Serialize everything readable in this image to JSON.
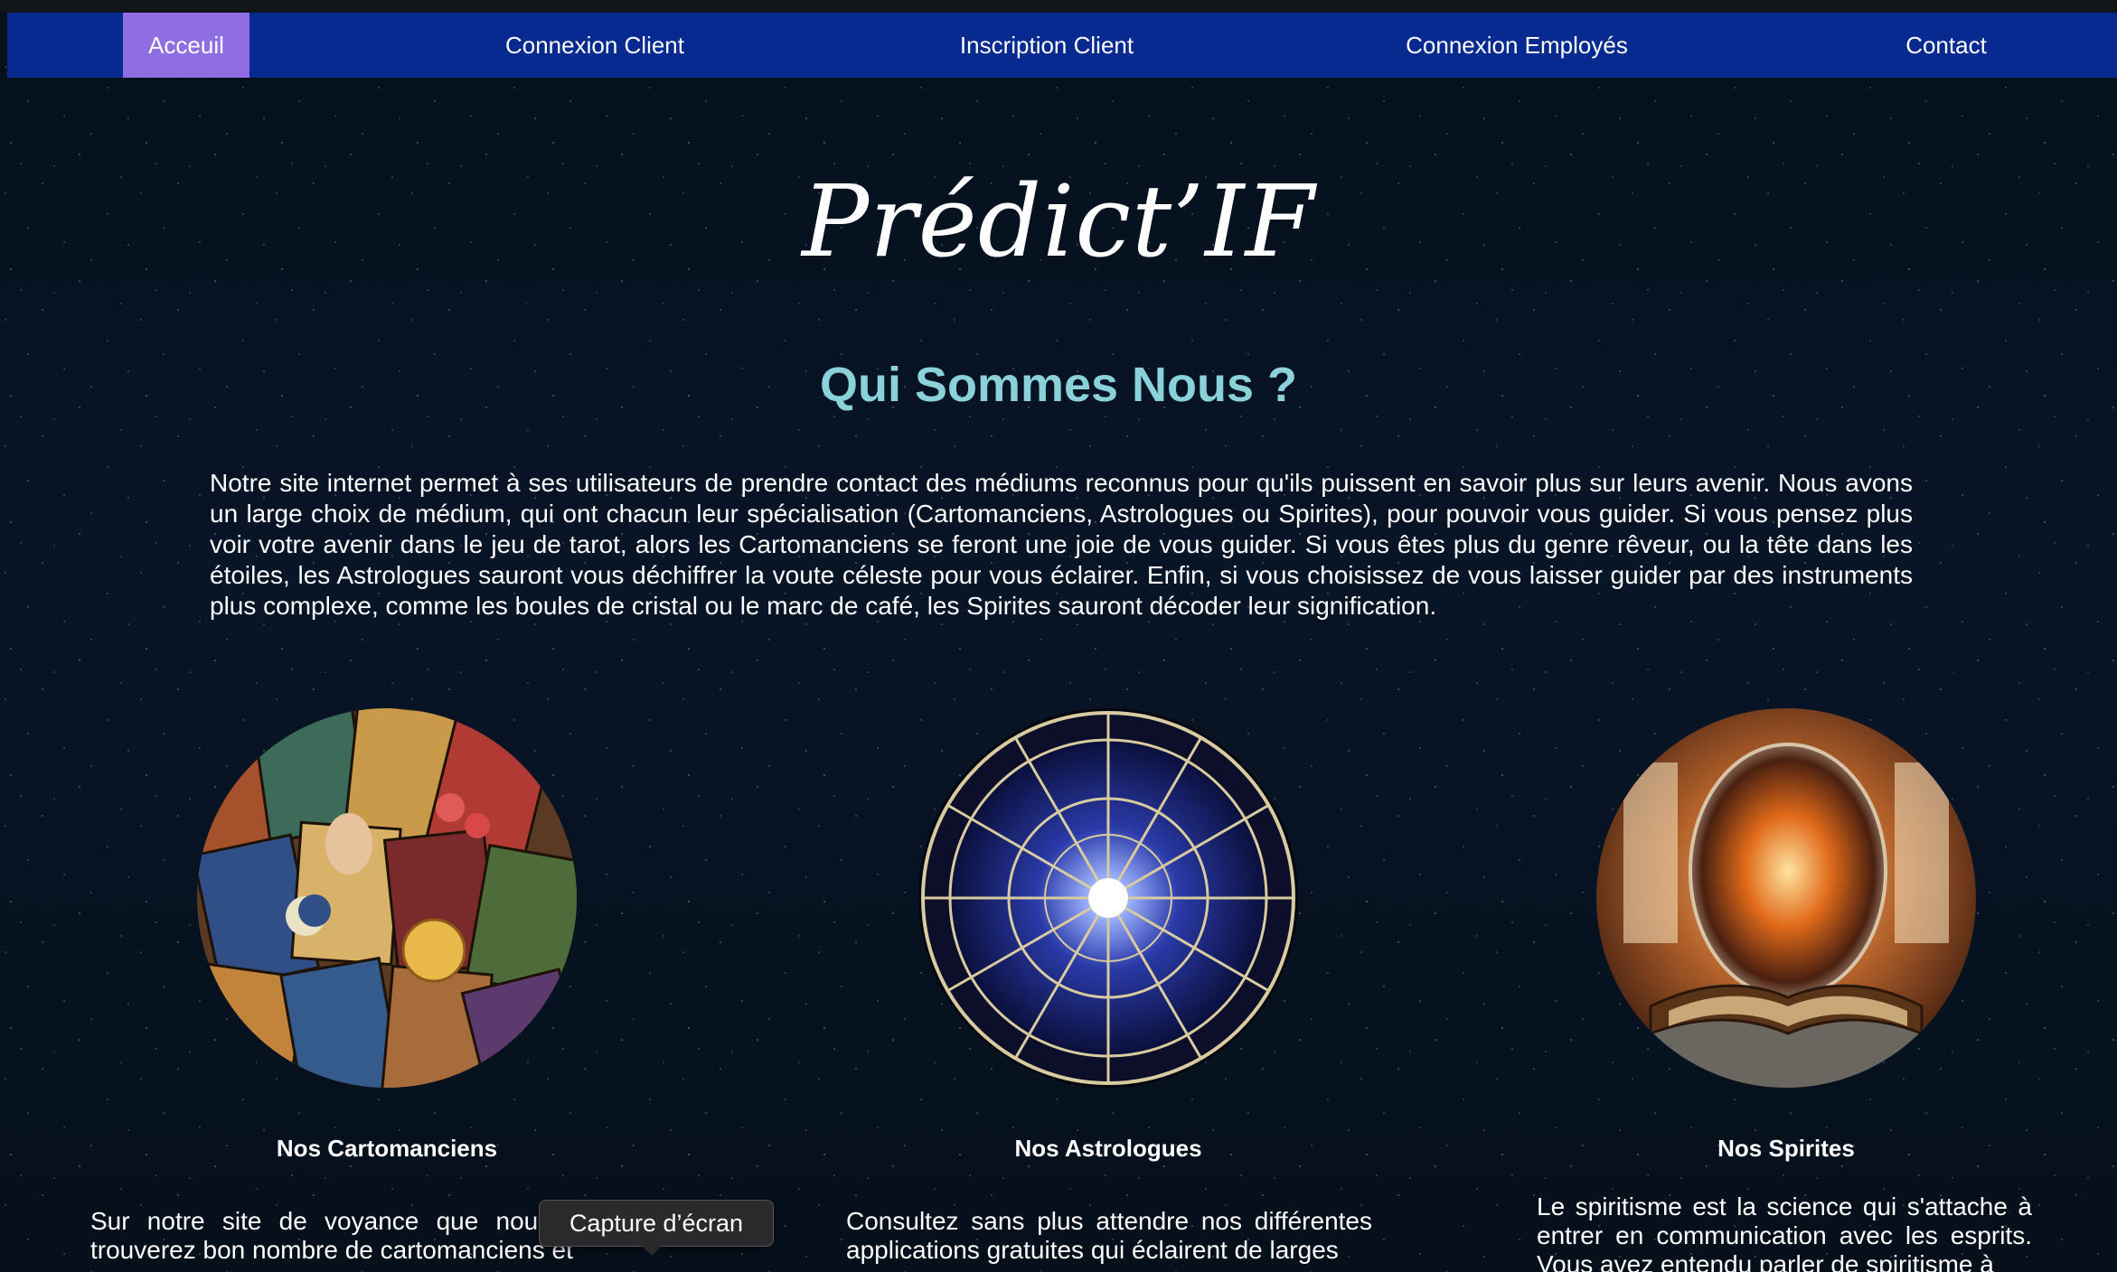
{
  "nav": {
    "items": [
      {
        "label": "Acceuil",
        "active": true
      },
      {
        "label": "Connexion Client",
        "active": false
      },
      {
        "label": "Inscription Client",
        "active": false
      },
      {
        "label": "Connexion Employés",
        "active": false
      },
      {
        "label": "Contact",
        "active": false
      }
    ],
    "background_color": "#072a91",
    "active_color": "#8f6ee4"
  },
  "logo": {
    "text": "Prédict’IF"
  },
  "about": {
    "title": "Qui Sommes Nous ?",
    "title_color": "#8ad1da",
    "text": "Notre site internet permet à ses utilisateurs de prendre contact des médiums reconnus pour qu'ils puissent en savoir plus sur leurs avenir. Nous avons un large choix de médium, qui ont chacun leur spécialisation (Cartomanciens, Astrologues ou Spirites), pour pouvoir vous guider. Si vous pensez plus voir votre avenir dans le jeu de tarot, alors les Cartomanciens se feront une joie de vous guider. Si vous êtes plus du genre rêveur, ou la tête dans les étoiles, les Astrologues sauront vous déchiffrer la voute céleste pour vous éclairer. Enfin, si vous choisissez de vous laisser guider par des instruments plus complexe, comme les boules de cristal ou le marc de café, les Spirites sauront décoder leur signification."
  },
  "cards": [
    {
      "image": "tarot-cards-image",
      "title": "Nos Cartomanciens",
      "text": "Sur notre site de voyance que nous vou                                   vous trouverez bon nombre de cartomanciens et"
    },
    {
      "image": "zodiac-wheel-image",
      "title": "Nos Astrologues",
      "text": "Consultez sans plus attendre nos différentes applications gratuites qui éclairent de larges"
    },
    {
      "image": "crystal-ball-image",
      "title": "Nos Spirites",
      "text": "Le spiritisme est la science qui s'attache à entrer en communication avec les esprits. Vous avez entendu parler de spiritisme à"
    }
  ],
  "tooltip": {
    "text": "Capture d’écran"
  }
}
